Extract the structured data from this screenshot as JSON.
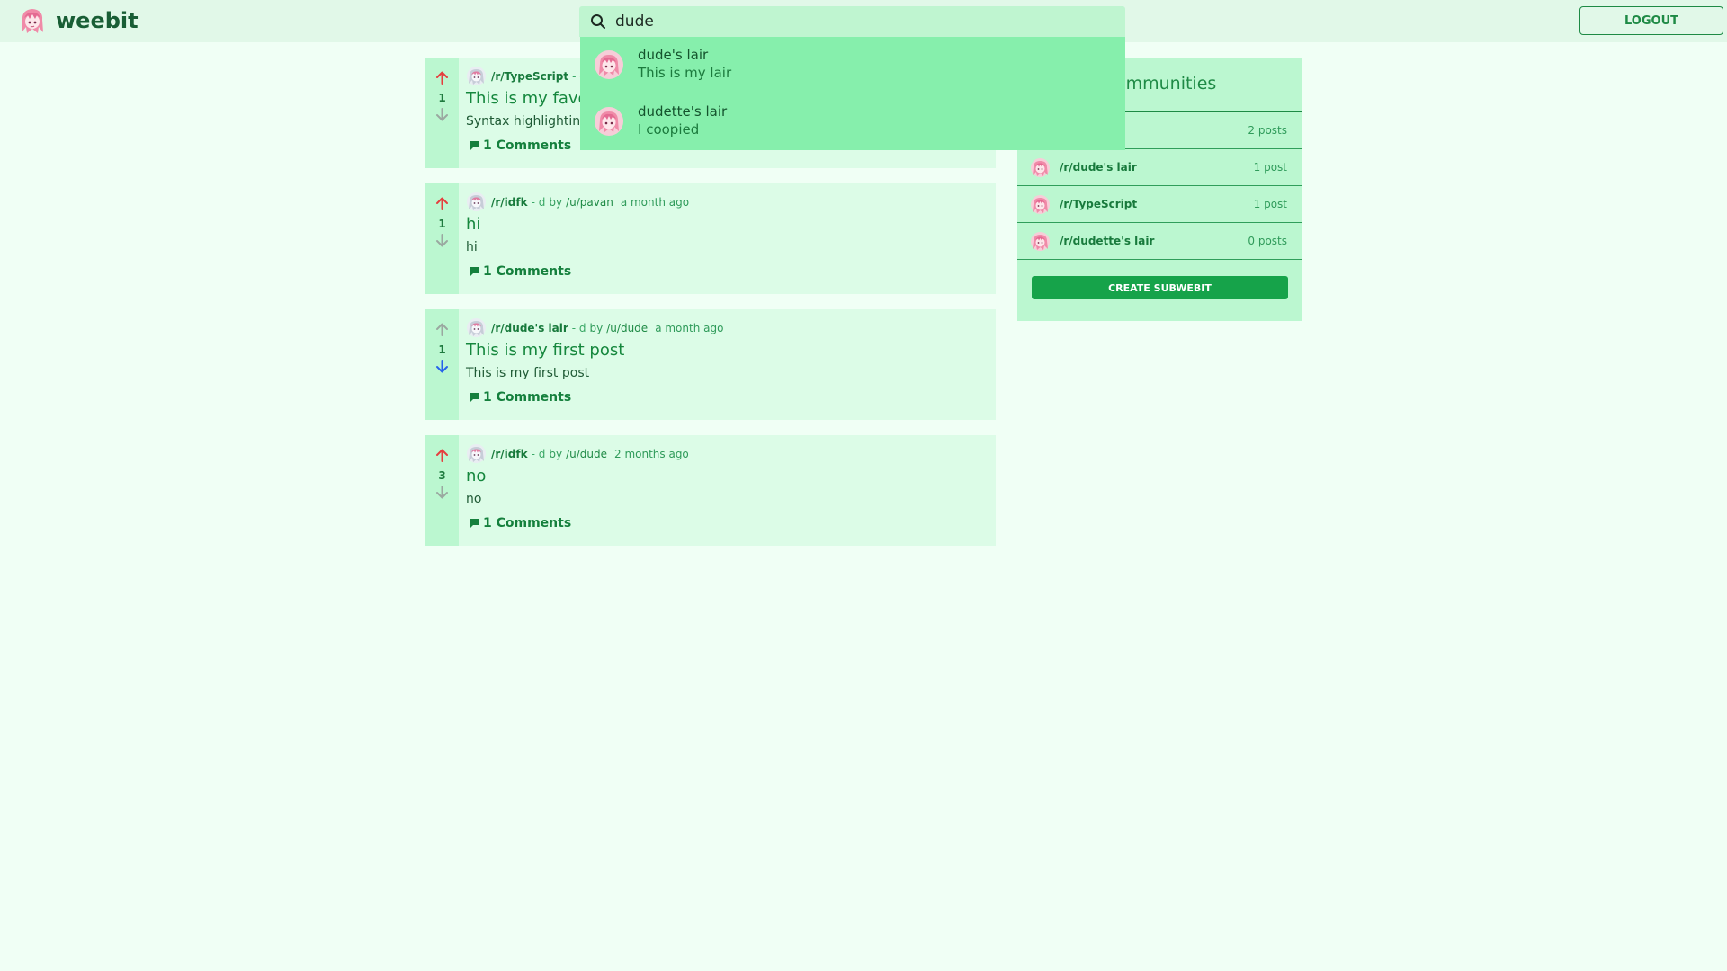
{
  "navbar": {
    "brand": "weebit",
    "logo_icon": "anime-avatar-icon",
    "search": {
      "value": "dude",
      "icon": "search-icon"
    },
    "logout_label": "LOGOUT"
  },
  "search_results": [
    {
      "name": "dude's lair",
      "description": "This is my lair"
    },
    {
      "name": "dudette's lair",
      "description": "I coopied"
    }
  ],
  "posts": [
    {
      "score": "1",
      "vote": "up",
      "subreddit": "/r/TypeScript",
      "meta_sep": "- d",
      "by": "",
      "user": "",
      "time": "",
      "title": "This is my favo",
      "body": "Syntax highlighting",
      "comments": "1 Comments"
    },
    {
      "score": "1",
      "vote": "up",
      "subreddit": "/r/idfk",
      "meta_sep": "- d",
      "by": "by",
      "user": "/u/pavan",
      "time": "a month ago",
      "title": "hi",
      "body": "hi",
      "comments": "1 Comments"
    },
    {
      "score": "1",
      "vote": "down",
      "subreddit": "/r/dude's lair",
      "meta_sep": "- d",
      "by": "by",
      "user": "/u/dude",
      "time": "a month ago",
      "title": "This is my first post",
      "body": "This is my first post",
      "comments": "1 Comments"
    },
    {
      "score": "3",
      "vote": "up",
      "subreddit": "/r/idfk",
      "meta_sep": "- d",
      "by": "by",
      "user": "/u/dude",
      "time": "2 months ago",
      "title": "no",
      "body": "no",
      "comments": "1 Comments"
    }
  ],
  "sidebar": {
    "title": "Communities",
    "communities": [
      {
        "name": "",
        "count": "2 posts"
      },
      {
        "name": "/r/dude's lair",
        "count": "1 post"
      },
      {
        "name": "/r/TypeScript",
        "count": "1 post"
      },
      {
        "name": "/r/dudette's lair",
        "count": "0 posts"
      }
    ],
    "create_label": "CREATE SUBWEBIT"
  },
  "colors": {
    "background": "#f0fff5",
    "accent": "#16a34a",
    "upvote_active": "#e53e3e",
    "downvote_active": "#2563eb",
    "vote_inactive": "#9aa8a0"
  }
}
